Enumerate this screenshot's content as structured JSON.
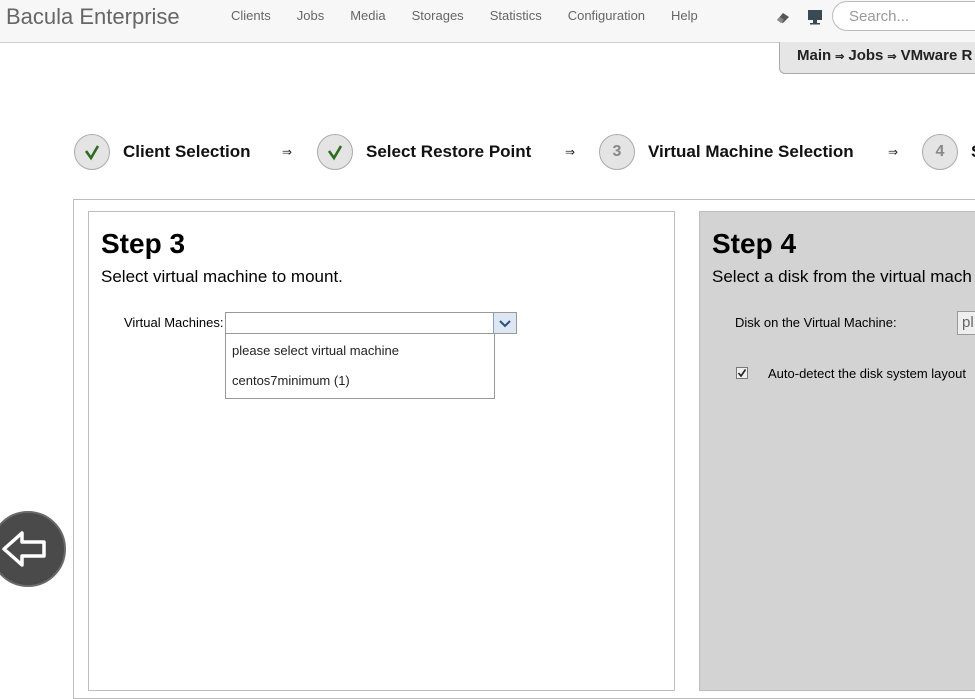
{
  "app": {
    "brand": "Bacula Enterprise"
  },
  "nav": {
    "items": [
      {
        "label": "Clients"
      },
      {
        "label": "Jobs"
      },
      {
        "label": "Media"
      },
      {
        "label": "Storages"
      },
      {
        "label": "Statistics"
      },
      {
        "label": "Configuration"
      },
      {
        "label": "Help"
      }
    ],
    "icons": [
      "eraser-icon",
      "monitor-icon"
    ]
  },
  "search": {
    "placeholder": "Search..."
  },
  "breadcrumb": {
    "items": [
      "Main",
      "Jobs",
      "VMware R"
    ],
    "separator": "⇒"
  },
  "wizard": {
    "arrow": "⇒",
    "steps": [
      {
        "mark": "✓",
        "label": "Client Selection",
        "done": true
      },
      {
        "mark": "✓",
        "label": "Select Restore Point",
        "done": true
      },
      {
        "mark": "3",
        "label": "Virtual Machine Selection",
        "done": false
      },
      {
        "mark": "4",
        "label": "S",
        "done": false
      }
    ]
  },
  "step3": {
    "title": "Step 3",
    "subtitle": "Select virtual machine to mount.",
    "vm_label": "Virtual Machines:",
    "vm_value": "",
    "options": [
      "please select virtual machine",
      "centos7minimum (1)"
    ]
  },
  "step4": {
    "title": "Step 4",
    "subtitle": "Select a disk from the virtual mach",
    "disk_label": "Disk on the Virtual Machine:",
    "disk_value": "pl",
    "autodetect_label": "Auto-detect the disk system layout",
    "autodetect_checked": true
  },
  "colors": {
    "done_check": "#2f6b1e",
    "panel4_bg": "#d3d3d3",
    "combo_btn": "#dde6f3"
  }
}
